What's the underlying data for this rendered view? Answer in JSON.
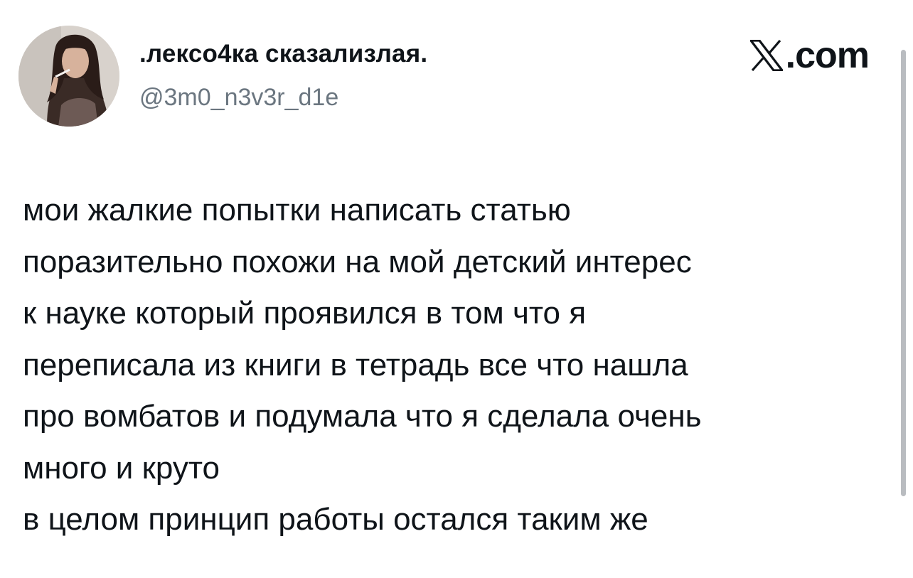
{
  "author": {
    "display_name": ".лексо4ка сказализлая.",
    "handle": "@3m0_n3v3r_d1e",
    "avatar_icon": "profile-photo"
  },
  "brand": {
    "logo_icon": "x-logo-icon",
    "suffix": ".com"
  },
  "tweet": {
    "text": "мои жалкие попытки написать статью\nпоразительно похожи на мой детский интерес\nк науке который проявился в том что я\nпереписала из книги в тетрадь все что нашла\nпро вомбатов и подумала что я сделала очень\nмного и круто\nв целом принцип работы остался таким же"
  },
  "colors": {
    "text": "#0f1419",
    "secondary": "#6b7680",
    "background": "#ffffff"
  }
}
